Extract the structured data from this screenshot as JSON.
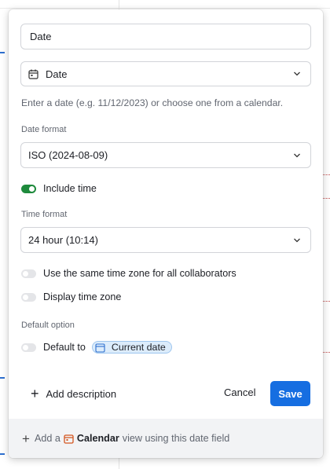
{
  "form": {
    "field_name": "Date",
    "field_type": "Date",
    "help_text": "Enter a date (e.g. 11/12/2023) or choose one from a calendar.",
    "date_format_label": "Date format",
    "date_format_value": "ISO (2024-08-09)",
    "include_time_label": "Include time",
    "include_time_on": true,
    "time_format_label": "Time format",
    "time_format_value": "24 hour (10:14)",
    "same_timezone_label": "Use the same time zone for all collaborators",
    "same_timezone_on": false,
    "display_timezone_label": "Display time zone",
    "display_timezone_on": false,
    "default_option_label": "Default option",
    "default_to_label": "Default to",
    "default_to_on": false,
    "default_chip": "Current date"
  },
  "actions": {
    "add_description": "Add description",
    "cancel": "Cancel",
    "save": "Save"
  },
  "footer": {
    "prefix": "Add a",
    "view_name": "Calendar",
    "suffix": "view using this date field"
  },
  "colors": {
    "accent": "#166ee1",
    "toggle_on": "#1e8a3c",
    "chip_bg": "#dcecfb",
    "calendar_icon": "#d4541e"
  },
  "icons": {
    "type_icon": "calendar-icon",
    "chevron": "chevron-down-icon",
    "chip_icon": "calendar-icon",
    "add": "plus-icon"
  }
}
